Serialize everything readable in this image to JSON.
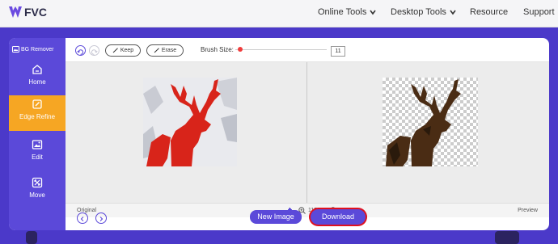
{
  "brand": {
    "name": "FVC"
  },
  "nav": {
    "online_tools": "Online Tools",
    "desktop_tools": "Desktop Tools",
    "resource": "Resource",
    "support": "Support"
  },
  "sidebar": {
    "title": "BG Remover",
    "items": [
      {
        "label": "Home",
        "icon": "home-icon"
      },
      {
        "label": "Edge Refine",
        "icon": "edit-icon",
        "active": true
      },
      {
        "label": "Edit",
        "icon": "image-icon"
      },
      {
        "label": "Move",
        "icon": "move-icon"
      }
    ]
  },
  "toolbar": {
    "keep_label": "Keep",
    "erase_label": "Erase",
    "brush_size_label": "Brush Size:",
    "brush_size_value": "11"
  },
  "viewer": {
    "original_label": "Original",
    "preview_label": "Preview",
    "zoom": "115%"
  },
  "actions": {
    "new_image": "New Image",
    "download": "Download"
  },
  "colors": {
    "accent": "#5b49d9",
    "active": "#f6a623",
    "highlight": "#e0101e",
    "brush": "#f03c3c"
  }
}
